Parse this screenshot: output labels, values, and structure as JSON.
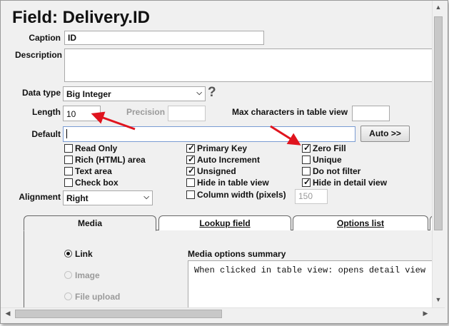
{
  "title": "Field: Delivery.ID",
  "caption": {
    "label": "Caption",
    "value": "ID"
  },
  "description": {
    "label": "Description",
    "value": ""
  },
  "data_type": {
    "label": "Data type",
    "value": "Big Integer",
    "help": "?"
  },
  "length": {
    "label": "Length",
    "value": "10"
  },
  "precision": {
    "label": "Precision",
    "value": ""
  },
  "max_chars": {
    "label": "Max characters in table view",
    "value": ""
  },
  "default": {
    "label": "Default",
    "value": ""
  },
  "auto_button": "Auto >>",
  "checkboxes": {
    "read_only": {
      "label": "Read Only",
      "checked": false
    },
    "rich_html": {
      "label": "Rich (HTML) area",
      "checked": false
    },
    "text_area": {
      "label": "Text area",
      "checked": false
    },
    "check_box": {
      "label": "Check box",
      "checked": false
    },
    "primary_key": {
      "label": "Primary Key",
      "checked": true
    },
    "auto_increment": {
      "label": "Auto Increment",
      "checked": true
    },
    "unsigned": {
      "label": "Unsigned",
      "checked": true
    },
    "hide_table": {
      "label": "Hide in table view",
      "checked": false
    },
    "column_width": {
      "label": "Column width (pixels)",
      "checked": false
    },
    "zero_fill": {
      "label": "Zero Fill",
      "checked": true
    },
    "unique": {
      "label": "Unique",
      "checked": false
    },
    "do_not_filter": {
      "label": "Do not filter",
      "checked": false
    },
    "hide_detail": {
      "label": "Hide in detail view",
      "checked": true
    }
  },
  "column_width_placeholder": "150",
  "alignment": {
    "label": "Alignment",
    "value": "Right"
  },
  "tabs": [
    {
      "label": "Media",
      "active": true
    },
    {
      "label": "Lookup field",
      "active": false
    },
    {
      "label": "Options list",
      "active": false
    }
  ],
  "media": {
    "options": [
      {
        "label": "Link",
        "selected": true,
        "enabled": true
      },
      {
        "label": "Image",
        "selected": false,
        "enabled": false
      },
      {
        "label": "File upload",
        "selected": false,
        "enabled": false
      }
    ],
    "summary_label": "Media options summary",
    "summary_text": "When clicked in table view: opens detail view"
  },
  "colors": {
    "arrow": "#e0141e",
    "background": "#f0f0f0",
    "disabled_text": "#9a9a9a"
  }
}
